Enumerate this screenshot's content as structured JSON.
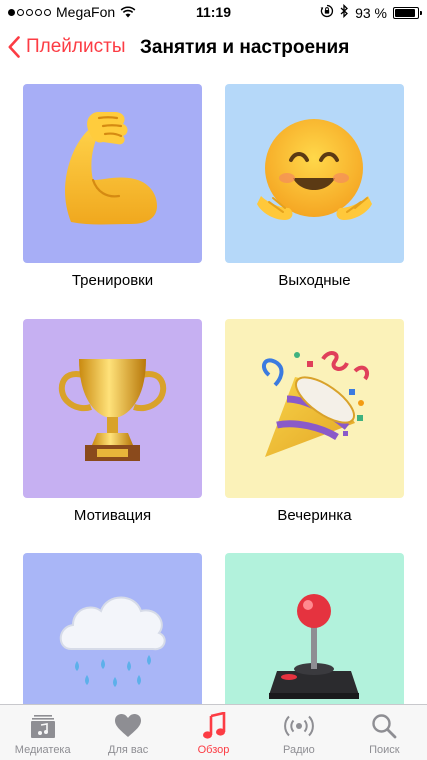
{
  "status_bar": {
    "carrier": "MegaFon",
    "time": "11:19",
    "battery": "93 %",
    "battery_level": 0.93,
    "signal_bars_filled": 1,
    "signal_bars_total": 5
  },
  "nav": {
    "back_label": "Плейлисты",
    "title": "Занятия и настроения"
  },
  "tiles": [
    {
      "label": "Тренировки",
      "icon": "flexed-biceps-icon",
      "bg": "#a7aef6"
    },
    {
      "label": "Выходные",
      "icon": "hugging-face-icon",
      "bg": "#b5d8f9"
    },
    {
      "label": "Мотивация",
      "icon": "trophy-icon",
      "bg": "#c6b0f2"
    },
    {
      "label": "Вечеринка",
      "icon": "party-popper-icon",
      "bg": "#fbf2b9"
    },
    {
      "label": "",
      "icon": "cloud-with-rain-icon",
      "bg": "#a9b6f7"
    },
    {
      "label": "",
      "icon": "joystick-icon",
      "bg": "#b2f2dc"
    }
  ],
  "tab_bar": {
    "items": [
      {
        "label": "Медиатека",
        "icon": "library-icon",
        "active": false
      },
      {
        "label": "Для вас",
        "icon": "heart-icon",
        "active": false
      },
      {
        "label": "Обзор",
        "icon": "music-note-icon",
        "active": true
      },
      {
        "label": "Радио",
        "icon": "radio-icon",
        "active": false
      },
      {
        "label": "Поиск",
        "icon": "search-icon",
        "active": false
      }
    ]
  },
  "colors": {
    "accent": "#fc3c44",
    "tab_inactive": "#8e8e93"
  }
}
